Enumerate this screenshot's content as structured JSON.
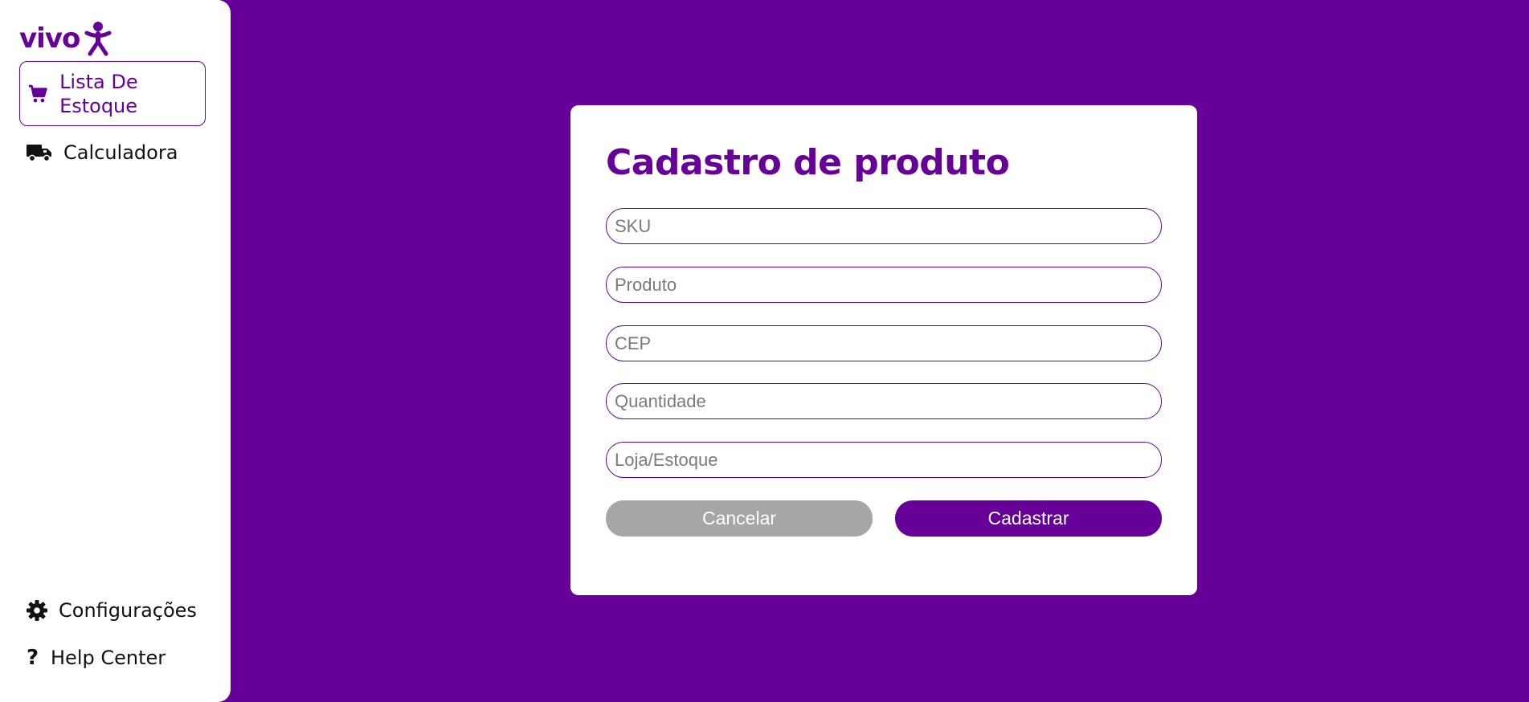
{
  "brand": {
    "logo_text": "vivo",
    "accent_color": "#660099"
  },
  "sidebar": {
    "items": [
      {
        "label": "Lista De Estoque",
        "icon": "cart-icon",
        "active": true
      },
      {
        "label": "Calculadora",
        "icon": "truck-icon",
        "active": false
      }
    ],
    "bottom_items": [
      {
        "label": "Configurações",
        "icon": "gear-icon"
      },
      {
        "label": "Help Center",
        "icon": "question-icon",
        "glyph": "?"
      }
    ]
  },
  "form": {
    "title": "Cadastro de produto",
    "fields": [
      {
        "placeholder": "SKU",
        "value": ""
      },
      {
        "placeholder": "Produto",
        "value": ""
      },
      {
        "placeholder": "CEP",
        "value": ""
      },
      {
        "placeholder": "Quantidade",
        "value": ""
      },
      {
        "placeholder": "Loja/Estoque",
        "value": ""
      }
    ],
    "cancel_label": "Cancelar",
    "submit_label": "Cadastrar"
  }
}
